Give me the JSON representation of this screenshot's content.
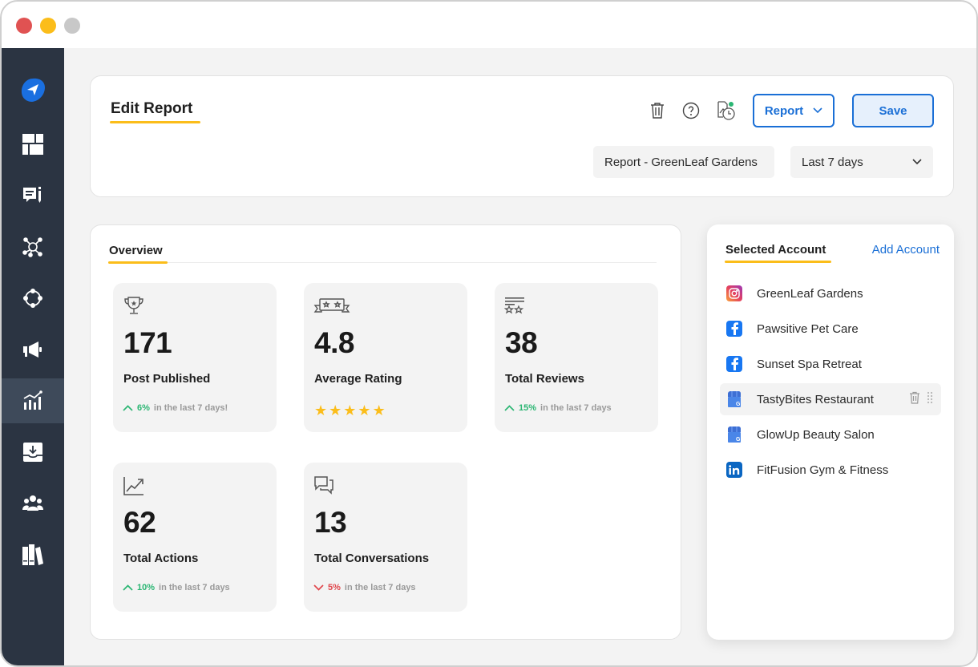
{
  "window": {
    "controls": [
      "close",
      "minimize",
      "maximize"
    ]
  },
  "sidebar": {
    "items": [
      {
        "name": "logo",
        "icon": "paper-plane-icon"
      },
      {
        "name": "dashboard",
        "icon": "dashboard-grid-icon"
      },
      {
        "name": "posts",
        "icon": "compose-message-icon"
      },
      {
        "name": "network",
        "icon": "network-nodes-icon"
      },
      {
        "name": "connections",
        "icon": "circle-nodes-icon"
      },
      {
        "name": "campaigns",
        "icon": "megaphone-icon"
      },
      {
        "name": "reports",
        "icon": "analytics-chart-icon",
        "active": true
      },
      {
        "name": "inbox",
        "icon": "inbox-download-icon"
      },
      {
        "name": "team",
        "icon": "users-group-icon"
      },
      {
        "name": "library",
        "icon": "books-library-icon"
      }
    ]
  },
  "header": {
    "title": "Edit Report",
    "report_button_label": "Report",
    "save_button_label": "Save",
    "report_name": "Report - GreenLeaf Gardens",
    "date_range": "Last 7 days",
    "icons": [
      "trash-icon",
      "help-icon",
      "schedule-report-icon"
    ]
  },
  "overview": {
    "tab_label": "Overview",
    "stats": [
      {
        "icon": "trophy-icon",
        "value": "171",
        "label": "Post Published",
        "trend": "up",
        "pct": "6%",
        "suffix": "in the last 7 days!"
      },
      {
        "icon": "rating-badge-icon",
        "value": "4.8",
        "label": "Average Rating",
        "stars": 5
      },
      {
        "icon": "reviews-icon",
        "value": "38",
        "label": "Total Reviews",
        "trend": "up",
        "pct": "15%",
        "suffix": "in the last 7 days"
      },
      {
        "icon": "trend-chart-icon",
        "value": "62",
        "label": "Total Actions",
        "trend": "up",
        "pct": "10%",
        "suffix": "in the last 7 days"
      },
      {
        "icon": "conversation-icon",
        "value": "13",
        "label": "Total Conversations",
        "trend": "down",
        "pct": "5%",
        "suffix": "in the last 7 days"
      }
    ]
  },
  "accounts": {
    "tab_label": "Selected Account",
    "add_label": "Add Account",
    "items": [
      {
        "name": "GreenLeaf Gardens",
        "platform": "instagram"
      },
      {
        "name": "Pawsitive Pet Care",
        "platform": "facebook"
      },
      {
        "name": "Sunset Spa Retreat",
        "platform": "facebook"
      },
      {
        "name": "TastyBites Restaurant",
        "platform": "google-business",
        "hovered": true
      },
      {
        "name": "GlowUp Beauty Salon",
        "platform": "google-business"
      },
      {
        "name": "FitFusion Gym & Fitness",
        "platform": "linkedin"
      }
    ]
  },
  "colors": {
    "accent": "#1a6fd6",
    "highlight": "#fbbd1a",
    "positive": "#2bb673",
    "negative": "#e0474c",
    "sidebar": "#2b3442"
  }
}
